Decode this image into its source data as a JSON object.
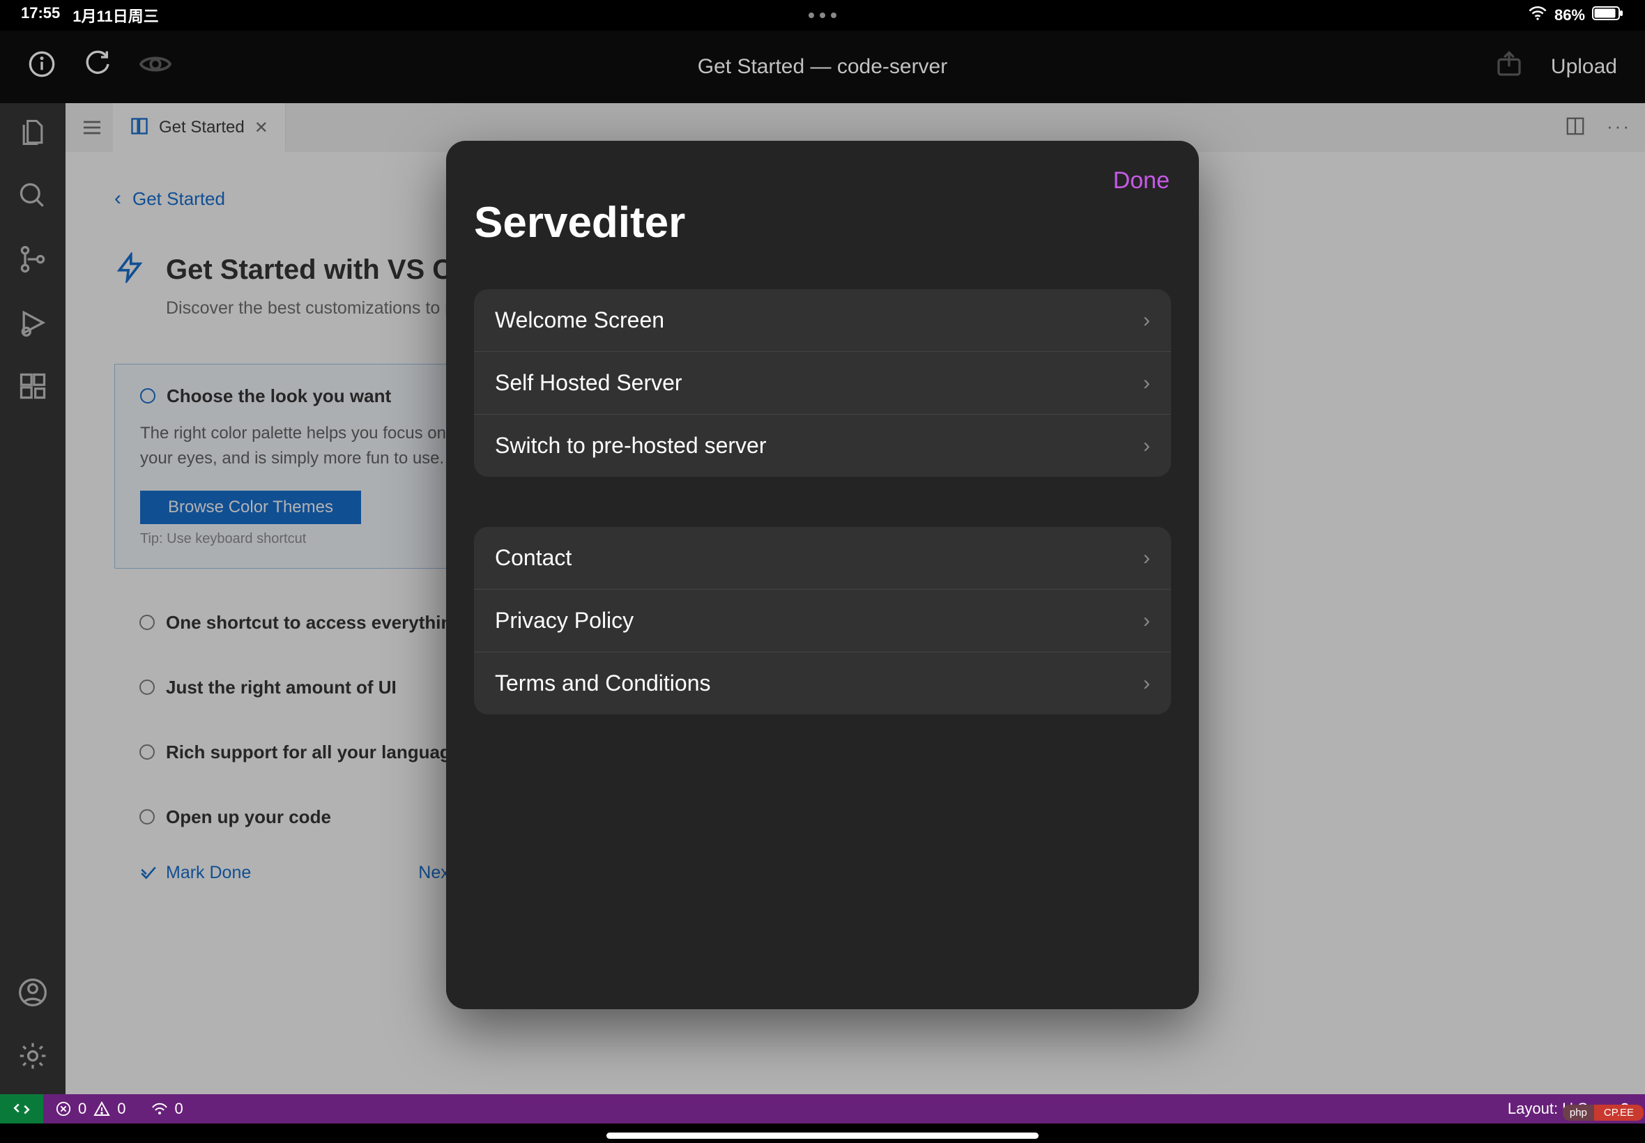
{
  "status": {
    "time": "17:55",
    "date": "1月11日周三",
    "battery_pct": "86%"
  },
  "toolbar": {
    "title": "Get Started — code-server",
    "upload": "Upload"
  },
  "tabs": {
    "active": "Get Started"
  },
  "breadcrumb": {
    "back": "Get Started"
  },
  "getstarted": {
    "title": "Get Started with VS Code in the Web",
    "subtitle": "Discover the best customizations to make VS Code in the Web yours.",
    "step_now": {
      "title": "Choose the look you want",
      "body": "The right color palette helps you focus on your code, is easy on your eyes, and is simply more fun to use.",
      "button": "Browse Color Themes",
      "tip": "Tip: Use keyboard shortcut"
    },
    "steps": {
      "s1": "One shortcut to access everything",
      "s2": "Just the right amount of UI",
      "s3": "Rich support for all your languages",
      "s4": "Open up your code"
    },
    "mark_done": "Mark Done",
    "next_section": "Next Section"
  },
  "statusbar": {
    "errors": "0",
    "warnings": "0",
    "ports": "0",
    "layout": "Layout: U.S."
  },
  "modal": {
    "done": "Done",
    "title": "Servediter",
    "group1": {
      "i0": "Welcome Screen",
      "i1": "Self Hosted Server",
      "i2": "Switch to pre-hosted server"
    },
    "group2": {
      "i0": "Contact",
      "i1": "Privacy Policy",
      "i2": "Terms and Conditions"
    }
  },
  "badge": {
    "left": "php",
    "right": "CP.EE"
  }
}
